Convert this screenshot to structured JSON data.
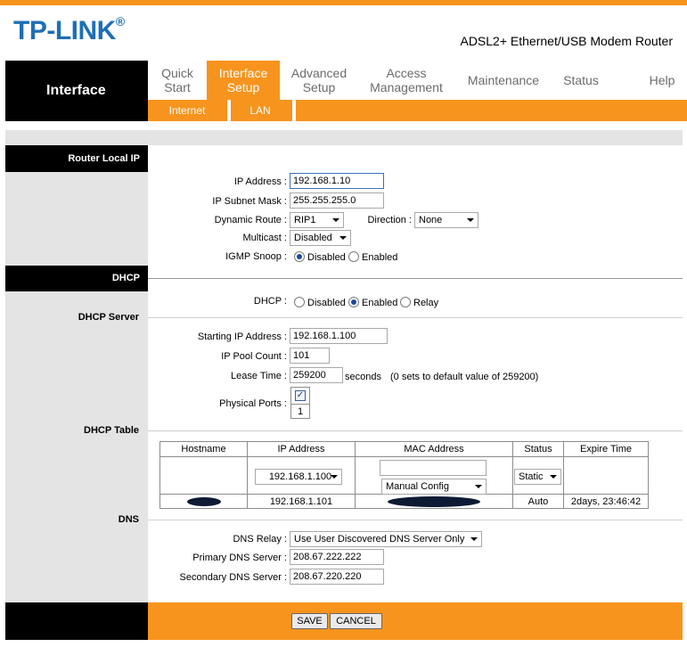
{
  "header": {
    "logo": "TP-LINK",
    "logo_mark": "®",
    "subtitle": "ADSL2+ Ethernet/USB Modem Router"
  },
  "section_title": "Interface",
  "nav": [
    {
      "line1": "Quick",
      "line2": "Start"
    },
    {
      "line1": "Interface",
      "line2": "Setup"
    },
    {
      "line1": "Advanced",
      "line2": "Setup"
    },
    {
      "line1": "Access",
      "line2": "Management"
    },
    {
      "line1": "Maintenance",
      "line2": ""
    },
    {
      "line1": "Status",
      "line2": ""
    },
    {
      "line1": "Help",
      "line2": ""
    }
  ],
  "subnav": [
    "Internet",
    "LAN"
  ],
  "router_ip": {
    "heading": "Router Local IP",
    "ip_label": "IP Address",
    "ip_value": "192.168.1.10",
    "mask_label": "IP Subnet Mask",
    "mask_value": "255.255.255.0",
    "route_label": "Dynamic Route",
    "route_value": "RIP1",
    "direction_label": "Direction",
    "direction_value": "None",
    "multicast_label": "Multicast",
    "multicast_value": "Disabled",
    "igmp_label": "IGMP Snoop",
    "igmp_disabled": "Disabled",
    "igmp_enabled": "Enabled"
  },
  "dhcp": {
    "heading": "DHCP",
    "label": "DHCP",
    "opt_disabled": "Disabled",
    "opt_enabled": "Enabled",
    "opt_relay": "Relay"
  },
  "dhcp_server": {
    "heading": "DHCP Server",
    "start_label": "Starting IP Address",
    "start_value": "192.168.1.100",
    "pool_label": "IP Pool Count",
    "pool_value": "101",
    "lease_label": "Lease Time",
    "lease_value": "259200",
    "lease_unit": "seconds",
    "lease_note": "(0 sets to default value of 259200)",
    "ports_label": "Physical Ports",
    "port_number": "1"
  },
  "dhcp_table": {
    "heading": "DHCP Table",
    "columns": [
      "Hostname",
      "IP Address",
      "MAC Address",
      "Status",
      "Expire Time"
    ],
    "edit_row": {
      "ip_select": "192.168.1.100",
      "mac_select": "Manual Config",
      "status_select": "Static"
    },
    "rows": [
      {
        "ip": "192.168.1.101",
        "status": "Auto",
        "expire": "2days, 23:46:42"
      }
    ]
  },
  "dns": {
    "heading": "DNS",
    "relay_label": "DNS Relay",
    "relay_value": "Use User Discovered DNS Server Only",
    "primary_label": "Primary DNS Server",
    "primary_value": "208.67.222.222",
    "secondary_label": "Secondary DNS Server",
    "secondary_value": "208.67.220.220"
  },
  "footer": {
    "save": "SAVE",
    "cancel": "CANCEL"
  },
  "colors": {
    "accent": "#f7941d",
    "logo": "#1e6fb5"
  }
}
